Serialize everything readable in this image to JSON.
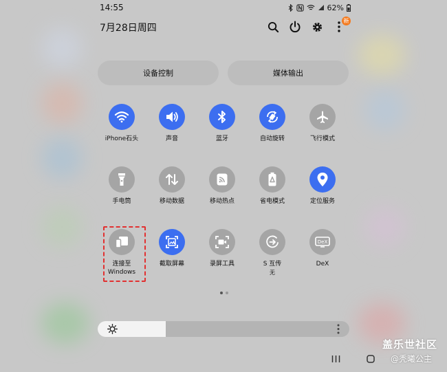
{
  "status_bar": {
    "time": "14:55",
    "battery": "62%"
  },
  "header": {
    "date": "7月28日周四",
    "new_badge": "新"
  },
  "pills": {
    "device_control": "设备控制",
    "media_output": "媒体输出"
  },
  "tiles": [
    {
      "label": "iPhone石头",
      "icon": "wifi-icon",
      "on": true
    },
    {
      "label": "声音",
      "icon": "sound-icon",
      "on": true
    },
    {
      "label": "蓝牙",
      "icon": "bluetooth-icon",
      "on": true
    },
    {
      "label": "自动旋转",
      "icon": "auto-rotate-icon",
      "on": true
    },
    {
      "label": "飞行模式",
      "icon": "airplane-icon",
      "on": false
    },
    {
      "label": "手电筒",
      "icon": "flashlight-icon",
      "on": false
    },
    {
      "label": "移动数据",
      "icon": "mobile-data-icon",
      "on": false
    },
    {
      "label": "移动热点",
      "icon": "hotspot-icon",
      "on": false
    },
    {
      "label": "省电模式",
      "icon": "power-saving-icon",
      "on": false
    },
    {
      "label": "定位服务",
      "icon": "location-icon",
      "on": true
    },
    {
      "label": "连接至\nWindows",
      "icon": "link-windows-icon",
      "on": false
    },
    {
      "label": "截取屏幕",
      "icon": "screenshot-icon",
      "on": true
    },
    {
      "label": "录屏工具",
      "icon": "screen-recorder-icon",
      "on": false
    },
    {
      "label": "S 互传",
      "sub": "无",
      "icon": "quick-share-icon",
      "on": false
    },
    {
      "label": "DeX",
      "icon": "dex-icon",
      "on": false
    }
  ],
  "brightness": {
    "level_percent": 27
  },
  "watermark": {
    "line1": "盖乐世社区",
    "line2": "@秃曦公主"
  },
  "colors": {
    "accent": "#3c6ef0",
    "tile_off": "#a5a5a5",
    "badge": "#f47b20"
  }
}
